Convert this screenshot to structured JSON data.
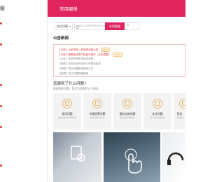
{
  "sidebar": {
    "brand": "服"
  },
  "header": {
    "title": "常用服务"
  },
  "search": {
    "select_label": "热点问题",
    "placeholder": "输入关键词查找相关问题和解答",
    "button": "在线客服",
    "extra": "★"
  },
  "notices": {
    "title": "公告新闻",
    "items": [
      {
        "text": "【公告】小米手机一体系统全面公告",
        "badge": "NEW"
      },
      {
        "text": "【公告】暑期活动用户权益升级中（点击查看）",
        "badge": "NEW"
      },
      {
        "text": "【公告】有关物流配送信息说明",
        "badge": ""
      },
      {
        "text": "【新闻】如何在官网查询订单物流信息",
        "badge": ""
      },
      {
        "text": "【新闻】常见问题使用指南汇总",
        "badge": ""
      },
      {
        "text": "【新闻】热点问题答疑解惑",
        "badge": ""
      }
    ]
  },
  "problems": {
    "title": "您遇到了什么问题?",
    "hint": "根据您的问题，我们为您推荐以下服务",
    "cards": [
      {
        "label": "常用问题",
        "desc": "快速查看高频问题解答",
        "icon": "doc-icon"
      },
      {
        "label": "充值消费问题",
        "desc": "充值消费相关咨询",
        "icon": "wallet-icon"
      },
      {
        "label": "服务咨询问题",
        "desc": "服务相关问题咨询",
        "icon": "service-icon"
      },
      {
        "label": "安全问题",
        "desc": "账号安全问题咨询",
        "icon": "shield-icon"
      },
      {
        "label": "投诉",
        "desc": "投诉建议",
        "icon": "complaint-icon"
      }
    ]
  },
  "colors": {
    "header": "#e0245e",
    "accent": "#d9312f",
    "card_bg": "#f3f3f3"
  }
}
